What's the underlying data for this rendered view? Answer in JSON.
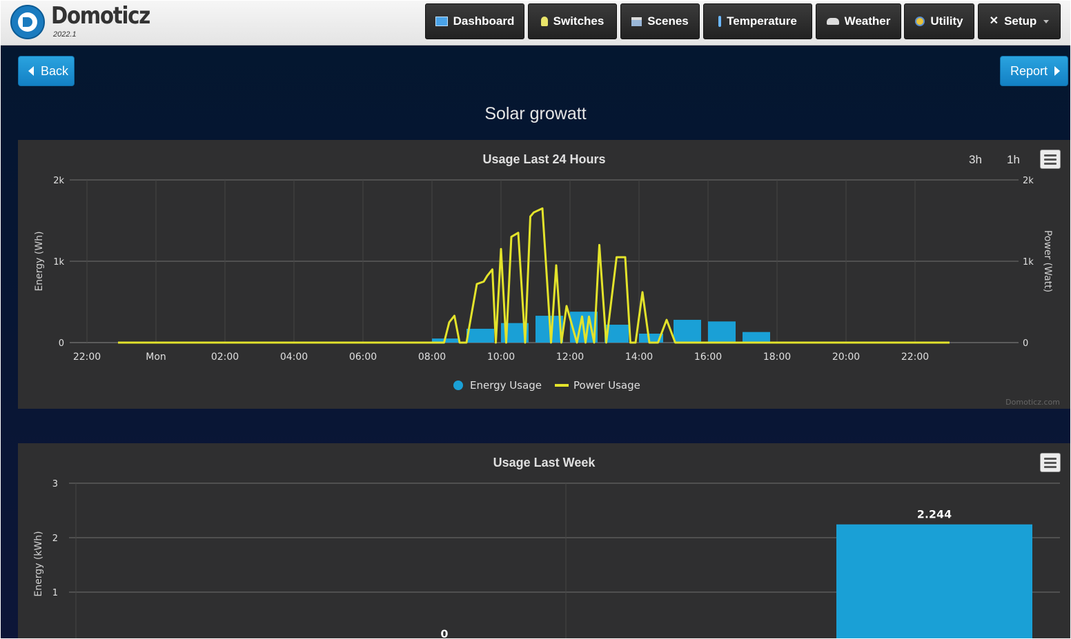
{
  "app": {
    "brand": "Domoticz",
    "version": "2022.1"
  },
  "nav": [
    {
      "label": "Dashboard",
      "icon": "dashboard-icon"
    },
    {
      "label": "Switches",
      "icon": "lightbulb-icon"
    },
    {
      "label": "Scenes",
      "icon": "clapperboard-icon"
    },
    {
      "label": "Temperature",
      "icon": "thermometer-icon"
    },
    {
      "label": "Weather",
      "icon": "cloud-rain-icon"
    },
    {
      "label": "Utility",
      "icon": "plug-icon"
    },
    {
      "label": "Setup",
      "icon": "tools-icon"
    }
  ],
  "buttons": {
    "back": "Back",
    "report": "Report"
  },
  "page": {
    "title": "Solar growatt"
  },
  "colors": {
    "energy": "#1aa0d6",
    "power": "#e3e32b",
    "panel": "#2f2f30",
    "accent": "#1a8fd2"
  },
  "chart_data": [
    {
      "type": "bar+line",
      "title": "Usage Last 24 Hours",
      "zoom_buttons": [
        "3h",
        "1h"
      ],
      "ylabel_left": "Energy (Wh)",
      "ylabel_right": "Power (Watt)",
      "ylim": [
        0,
        2000
      ],
      "y_ticks": [
        "0",
        "1k",
        "2k"
      ],
      "x_ticks": [
        "22:00",
        "Mon",
        "02:00",
        "04:00",
        "06:00",
        "08:00",
        "10:00",
        "12:00",
        "14:00",
        "16:00",
        "18:00",
        "20:00",
        "22:00"
      ],
      "xlim_hours": [
        -2.5,
        25
      ],
      "legend": [
        "Energy Usage",
        "Power Usage"
      ],
      "legend_position": "bottom-center",
      "credits": "Domoticz.com",
      "series": [
        {
          "name": "Energy Usage",
          "type": "column",
          "x_start": [
            8.0,
            9.0,
            10.0,
            11.0,
            12.0,
            13.0,
            14.0,
            15.0,
            16.0,
            17.0
          ],
          "x_end": [
            8.8,
            9.8,
            10.8,
            11.8,
            12.8,
            13.7,
            14.7,
            15.8,
            16.8,
            17.8
          ],
          "values": [
            50,
            170,
            240,
            330,
            380,
            220,
            110,
            280,
            260,
            130
          ]
        },
        {
          "name": "Power Usage",
          "type": "line",
          "x": [
            -1.1,
            8.35,
            8.5,
            8.65,
            8.8,
            9.0,
            9.3,
            9.5,
            9.6,
            9.75,
            9.85,
            10.0,
            10.15,
            10.3,
            10.5,
            10.7,
            10.85,
            10.95,
            11.2,
            11.45,
            11.6,
            11.75,
            11.9,
            12.2,
            12.35,
            12.45,
            12.55,
            12.7,
            12.85,
            13.05,
            13.35,
            13.6,
            13.75,
            13.9,
            14.1,
            14.3,
            14.55,
            14.8,
            15.05,
            15.2,
            15.4,
            15.55,
            15.75,
            15.9,
            16.1,
            16.3,
            16.5,
            16.75,
            17.0,
            17.2,
            17.5,
            17.7,
            18.0,
            23.0
          ],
          "values": [
            0,
            0,
            250,
            330,
            0,
            0,
            720,
            750,
            820,
            900,
            0,
            1150,
            0,
            1300,
            1350,
            0,
            1550,
            1600,
            1650,
            0,
            950,
            0,
            450,
            0,
            320,
            0,
            320,
            0,
            1200,
            0,
            1050,
            1050,
            0,
            0,
            620,
            0,
            0,
            280,
            0,
            0,
            0,
            0,
            0,
            0,
            0,
            0,
            0,
            0,
            0,
            0,
            0,
            0,
            0,
            0
          ]
        }
      ]
    },
    {
      "type": "bar",
      "title": "Usage Last Week",
      "ylabel": "Energy (kWh)",
      "ylim": [
        0,
        3
      ],
      "y_ticks": [
        "1",
        "2",
        "3"
      ],
      "data_labels": [
        "0",
        "2.244"
      ],
      "values": [
        0,
        2.244
      ]
    }
  ]
}
